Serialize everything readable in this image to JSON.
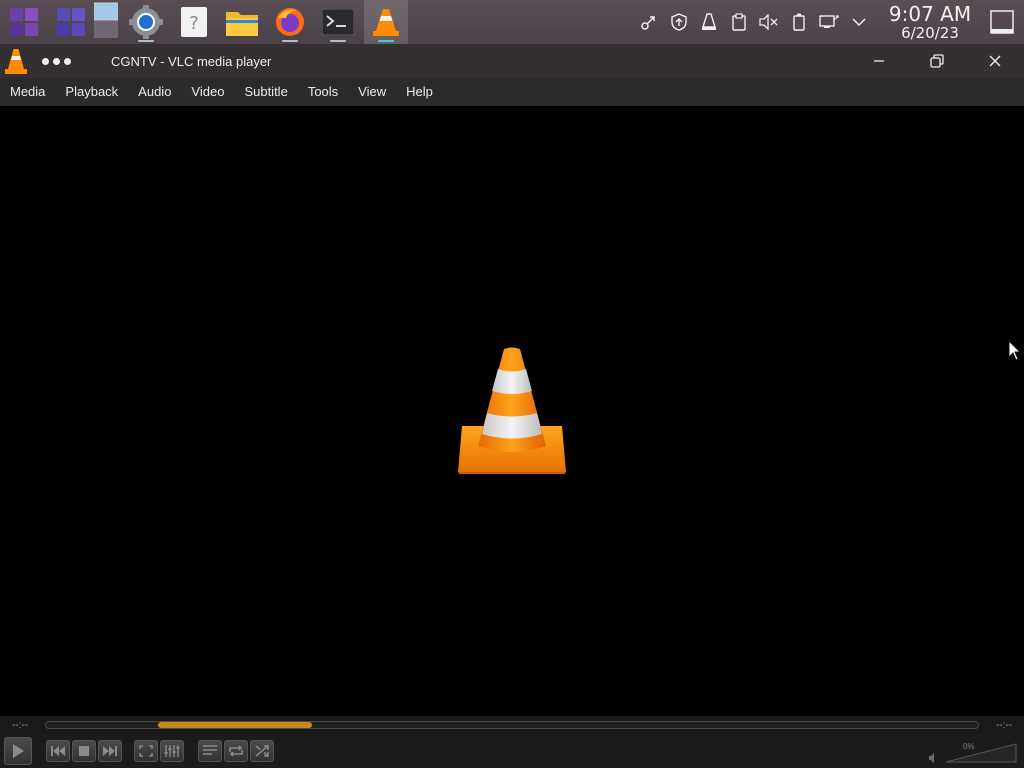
{
  "taskbar": {
    "apps": [
      {
        "name": "app-launcher-icon",
        "active": false
      },
      {
        "name": "overview-icon",
        "active": false
      },
      {
        "name": "desktop-pager-icon",
        "active": false
      },
      {
        "name": "system-settings-icon",
        "active": false
      },
      {
        "name": "help-icon",
        "active": false
      },
      {
        "name": "file-manager-icon",
        "active": false
      },
      {
        "name": "firefox-icon",
        "active": false
      },
      {
        "name": "terminal-icon",
        "active": false
      },
      {
        "name": "vlc-icon",
        "active": true
      }
    ],
    "tray": [
      "kde-connect-icon",
      "update-icon",
      "vlc-tray-icon",
      "clipboard-icon",
      "volume-muted-icon",
      "battery-icon",
      "network-icon",
      "expand-tray-icon"
    ],
    "clock": {
      "time": "9:07 AM",
      "date": "6/20/23"
    }
  },
  "window": {
    "title": "CGNTV - VLC media player",
    "menu": [
      "Media",
      "Playback",
      "Audio",
      "Video",
      "Subtitle",
      "Tools",
      "View",
      "Help"
    ]
  },
  "player": {
    "elapsed": "--:--",
    "remaining": "--:--",
    "volume_label": "0%",
    "volume_level": 0.0,
    "seek_progress_start": 0.12,
    "seek_progress_end": 0.285,
    "accent": "#c8871f"
  }
}
